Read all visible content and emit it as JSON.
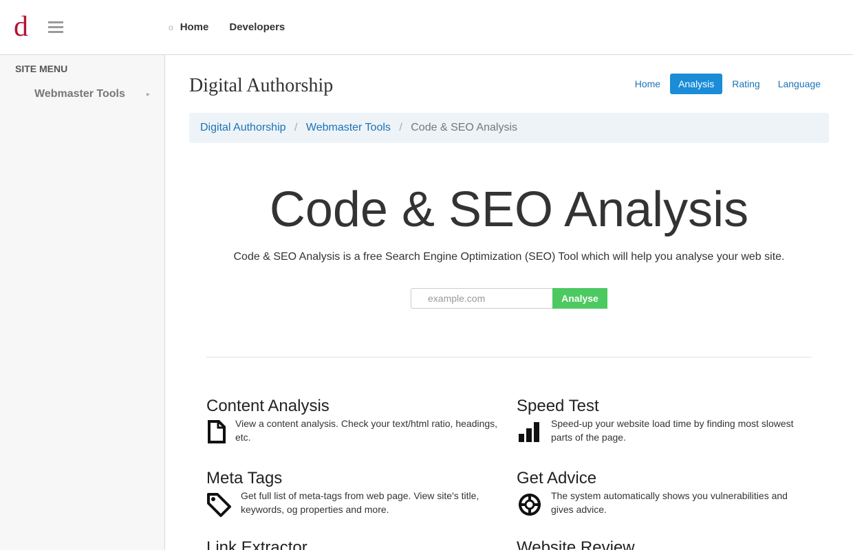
{
  "brand": {
    "logo": "d",
    "color": "#b71234"
  },
  "topnav": [
    {
      "icon": "home-icon",
      "glyph": "o",
      "label": "Home"
    },
    {
      "icon": "code-icon",
      "glyph": "",
      "label": "Developers"
    }
  ],
  "sidebar": {
    "heading": "SITE MENU",
    "items": [
      {
        "icon": "wrench-icon",
        "glyph": "",
        "label": "Webmaster Tools",
        "arrow": "▸"
      }
    ]
  },
  "site_title": "Digital Authorship",
  "pills": [
    {
      "label": "Home",
      "active": false
    },
    {
      "label": "Analysis",
      "active": true
    },
    {
      "label": "Rating",
      "active": false
    },
    {
      "label": "Language",
      "active": false
    }
  ],
  "breadcrumb": {
    "items": [
      "Digital Authorship",
      "Webmaster Tools"
    ],
    "current": "Code & SEO Analysis",
    "separator": "/"
  },
  "hero": {
    "title": "Code & SEO Analysis",
    "subtitle": "Code & SEO Analysis is a free Search Engine Optimization (SEO) Tool which will help you analyse your web site.",
    "placeholder": "example.com",
    "button": "Analyse",
    "button_color": "#4cc960"
  },
  "features": [
    {
      "title": "Content Analysis",
      "icon": "file-icon",
      "text": "View a content analysis. Check your text/html ratio, headings, etc."
    },
    {
      "title": "Speed Test",
      "icon": "bar-chart-icon",
      "text": "Speed-up your website load time by finding most slowest parts of the page."
    },
    {
      "title": "Meta Tags",
      "icon": "tag-icon",
      "text": "Get full list of meta-tags from web page. View site's title, keywords, og properties and more."
    },
    {
      "title": "Get Advice",
      "icon": "crosshair-icon",
      "text": "The system automatically shows you vulnerabilities and gives advice."
    },
    {
      "title": "Link Extractor",
      "icon": "link-icon",
      "text": ""
    },
    {
      "title": "Website Review",
      "icon": "review-icon",
      "text": ""
    }
  ],
  "accent_color": "#1a8cd8"
}
